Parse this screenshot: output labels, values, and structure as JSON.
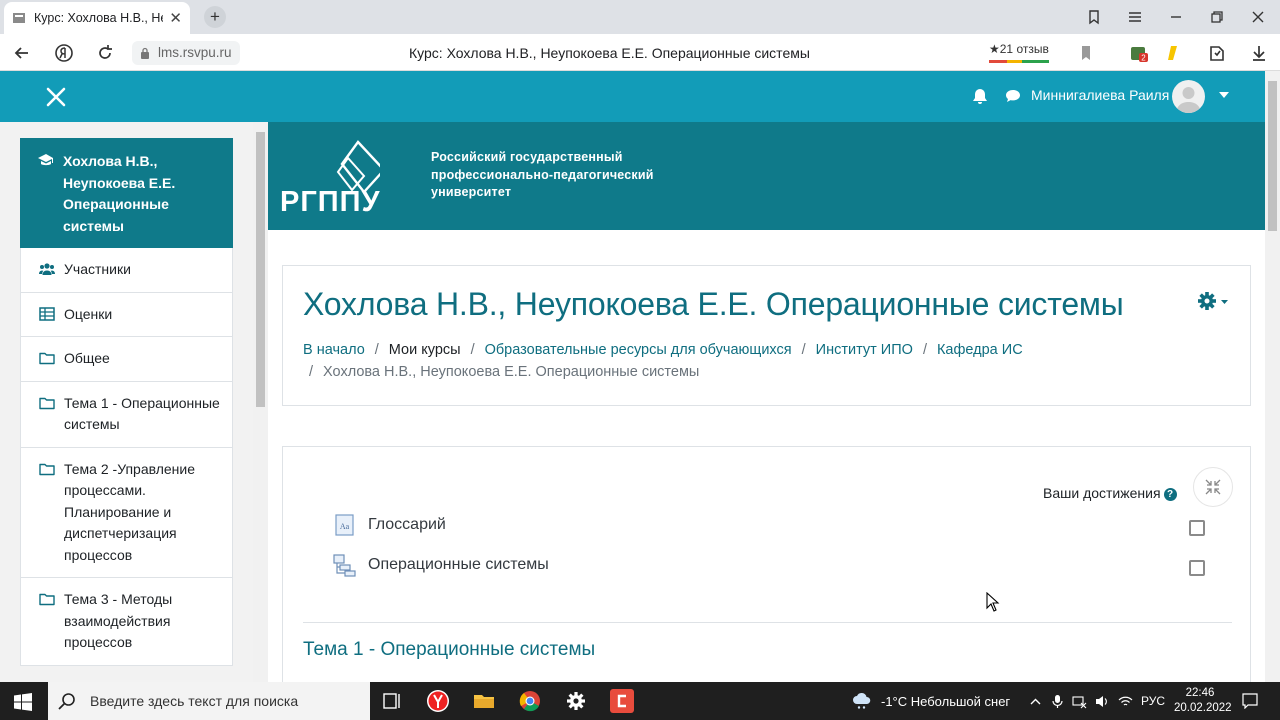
{
  "browser": {
    "tab_title": "Курс: Хохлова Н.В., Неу",
    "url": "lms.rsvpu.ru",
    "page_title": "Курс: Хохлова Н.В., Неупокоева Е.Е. Операционные системы",
    "reviews": "★21 отзыв"
  },
  "header": {
    "user_name": "Миннигалиева Раиля",
    "bar_color": "#129cb8"
  },
  "sidebar": {
    "items": [
      {
        "label": "Хохлова Н.В., Неупокоева Е.Е. Операционные системы",
        "icon": "graduation-cap-icon"
      },
      {
        "label": "Участники",
        "icon": "users-icon"
      },
      {
        "label": "Оценки",
        "icon": "table-icon"
      },
      {
        "label": "Общее",
        "icon": "folder-icon"
      },
      {
        "label": "Тема 1 - Операционные системы",
        "icon": "folder-icon"
      },
      {
        "label": "Тема 2 -Управление процессами. Планирование и диспетчеризация процессов",
        "icon": "folder-icon"
      },
      {
        "label": "Тема 3 - Методы взаимодействия процессов",
        "icon": "folder-icon"
      }
    ]
  },
  "banner": {
    "logo_text": "РГППУ",
    "university": [
      "Российский государственный",
      "профессионально-педагогический",
      "университет"
    ],
    "color": "#0f7a8a"
  },
  "course": {
    "title": "Хохлова Н.В., Неупокоева Е.Е. Операционные системы",
    "breadcrumb": [
      "В начало",
      "Мои курсы",
      "Образовательные ресурсы для обучающихся",
      "Институт ИПО",
      "Кафедра ИС",
      "Хохлова Н.В., Неупокоева Е.Е. Операционные системы"
    ]
  },
  "content": {
    "achievements_label": "Ваши достижения",
    "activities": [
      {
        "label": "Глоссарий",
        "icon": "glossary-icon"
      },
      {
        "label": "Операционные системы",
        "icon": "book-icon"
      }
    ],
    "topic1_title": "Тема 1 - Операционные системы"
  },
  "taskbar": {
    "search_placeholder": "Введите здесь текст для поиска",
    "weather": "-1°C  Небольшой снег",
    "lang": "РУС",
    "time": "22:46",
    "date": "20.02.2022"
  }
}
